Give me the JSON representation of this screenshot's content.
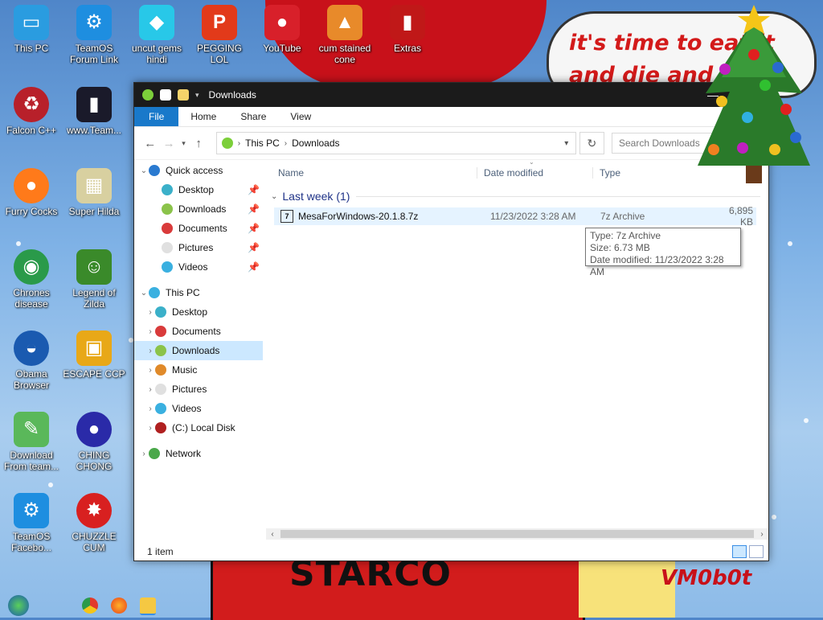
{
  "wallpaper": {
    "bubble_text": "it's time to eat it and die and",
    "banner_text": "STARCO",
    "signature_text": "VM0b0t"
  },
  "desktop_icons": [
    {
      "label": "This PC",
      "icon": "monitor-icon",
      "color": "#2a9ce0"
    },
    {
      "label": "TeamOS Forum Link",
      "icon": "gear-icon",
      "color": "#1e8ee0"
    },
    {
      "label": "uncut gems hindi",
      "icon": "gem-icon",
      "color": "#28c8e8"
    },
    {
      "label": "PEGGING LOL",
      "icon": "p-logo-icon",
      "color": "#e23a1a"
    },
    {
      "label": "YouTube",
      "icon": "angry-bird-icon",
      "color": "#d8202a"
    },
    {
      "label": "cum stained cone",
      "icon": "cone-icon",
      "color": "#e88a2a"
    },
    {
      "label": "Extras",
      "icon": "book-icon",
      "color": "#c01818"
    },
    {
      "label": "Falcon C++",
      "icon": "recycle-icon",
      "color": "#b8202a"
    },
    {
      "label": "www.Team...",
      "icon": "book-dark-icon",
      "color": "#1a1a2a"
    },
    {
      "label": "Furry Cocks",
      "icon": "firefox-icon",
      "color": "#ff7a1a"
    },
    {
      "label": "Super Hilda",
      "icon": "pixel-icon",
      "color": "#d8d0a0"
    },
    {
      "label": "Chrones disease",
      "icon": "chrome-icon",
      "color": "#2a9a4a"
    },
    {
      "label": "Legend of Zilda",
      "icon": "zelda-icon",
      "color": "#3a8a2a"
    },
    {
      "label": "Obama Browser",
      "icon": "obama-logo-icon",
      "color": "#1a5ab0"
    },
    {
      "label": "ESCAPE CCP",
      "icon": "escape-icon",
      "color": "#e8a818"
    },
    {
      "label": "Download From team...",
      "icon": "notepad-icon",
      "color": "#5ab85a"
    },
    {
      "label": "CHING CHONG",
      "icon": "orb-icon",
      "color": "#2a2aa8"
    },
    {
      "label": "TeamOS Facebo...",
      "icon": "gear-icon",
      "color": "#1e8ee0"
    },
    {
      "label": "CHUZZLE CUM",
      "icon": "chuzzle-icon",
      "color": "#d82020"
    }
  ],
  "window": {
    "title": "Downloads",
    "ribbon_tabs": [
      "File",
      "Home",
      "Share",
      "View"
    ],
    "breadcrumb": [
      "This PC",
      "Downloads"
    ],
    "search_placeholder": "Search Downloads",
    "columns": {
      "name": "Name",
      "date": "Date modified",
      "type": "Type"
    },
    "group": {
      "label": "Last week (1)"
    },
    "files": [
      {
        "name": "MesaForWindows-20.1.8.7z",
        "date": "11/23/2022 3:28 AM",
        "type": "7z Archive",
        "size": "6,895 KB"
      }
    ],
    "tooltip": {
      "type_line": "Type: 7z Archive",
      "size_line": "Size: 6.73 MB",
      "date_line": "Date modified: 11/23/2022 3:28 AM"
    },
    "nav": {
      "quick_access": {
        "label": "Quick access",
        "items": [
          "Desktop",
          "Downloads",
          "Documents",
          "Pictures",
          "Videos"
        ]
      },
      "this_pc": {
        "label": "This PC",
        "items": [
          "Desktop",
          "Documents",
          "Downloads",
          "Music",
          "Pictures",
          "Videos",
          "(C:) Local Disk"
        ]
      },
      "network": {
        "label": "Network"
      }
    },
    "status": "1 item"
  },
  "colors": {
    "accent": "#1979ca",
    "selection": "#cce8ff",
    "hover": "#e5f3ff",
    "titlebar": "#1b1b1b"
  }
}
